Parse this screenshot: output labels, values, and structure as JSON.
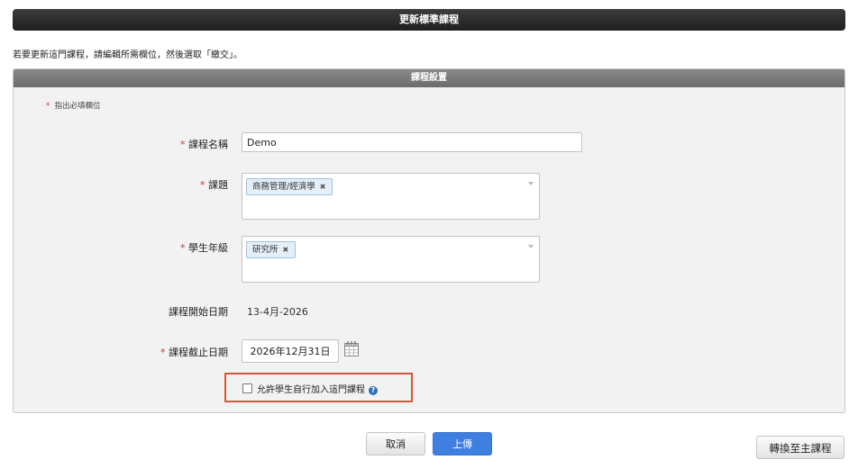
{
  "header": {
    "title": "更新標準課程"
  },
  "instructions": "若要更新這門課程，請編輯所需欄位，然後選取「繳交」。",
  "panel": {
    "title": "課程設置",
    "required_note": "指出必填欄位",
    "required_star": "*"
  },
  "form": {
    "course_name": {
      "label": "課程名稱",
      "value": "Demo"
    },
    "subject": {
      "label": "課題",
      "tags": [
        "商務管理/經濟學"
      ]
    },
    "grade_level": {
      "label": "學生年級",
      "tags": [
        "研究所"
      ]
    },
    "start_date": {
      "label": "課程開始日期",
      "value": "13-4月-2026"
    },
    "end_date": {
      "label": "課程截止日期",
      "value": "2026年12月31日"
    },
    "self_enroll": {
      "label": "允許學生自行加入這門課程",
      "checked": false,
      "help_icon": "?"
    },
    "tag_remove_symbol": "✖"
  },
  "buttons": {
    "cancel": "取消",
    "upload": "上傳",
    "convert": "轉換至主課程"
  },
  "colors": {
    "primary": "#3f7fe0",
    "required": "#c0392b",
    "highlight_border": "#d5573b",
    "tag_bg": "#e5eff8"
  }
}
